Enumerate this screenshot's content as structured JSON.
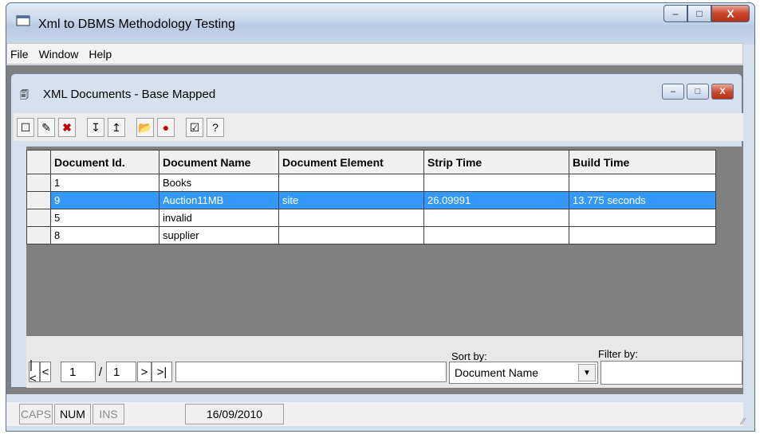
{
  "window": {
    "title": "Xml to DBMS Methodology Testing",
    "caption_buttons": {
      "minimize": "–",
      "maximize": "□",
      "close": "X"
    }
  },
  "menu": [
    "File",
    "Window",
    "Help"
  ],
  "child": {
    "title": "XML Documents - Base Mapped",
    "caption_buttons": {
      "minimize": "–",
      "maximize": "□",
      "close": "X"
    }
  },
  "toolbar": {
    "icons": [
      "new-icon",
      "edit-icon",
      "delete-icon",
      "import-icon",
      "export-icon",
      "open-folder-icon",
      "search-icon",
      "check-icon",
      "help-icon"
    ]
  },
  "grid": {
    "columns": [
      "Document Id.",
      "Document Name",
      "Document Element",
      "Strip Time",
      "Build Time"
    ],
    "rows": [
      [
        "1",
        "Books",
        "",
        "",
        ""
      ],
      [
        "9",
        "Auction11MB",
        "site",
        "26.09991",
        "13.775 seconds"
      ],
      [
        "5",
        "invalid",
        "",
        "",
        ""
      ],
      [
        "8",
        "supplier",
        "",
        "",
        ""
      ]
    ],
    "selected_row": 1
  },
  "navigator": {
    "first": "|<",
    "prev": "<",
    "page": "1",
    "separator": "/",
    "total": "1",
    "next": ">",
    "last": ">|"
  },
  "sort": {
    "label": "Sort by:",
    "value": "Document Name"
  },
  "filter": {
    "label": "Filter by:",
    "value": ""
  },
  "status": {
    "caps": "CAPS",
    "num": "NUM",
    "ins": "INS",
    "date": "16/09/2010"
  }
}
